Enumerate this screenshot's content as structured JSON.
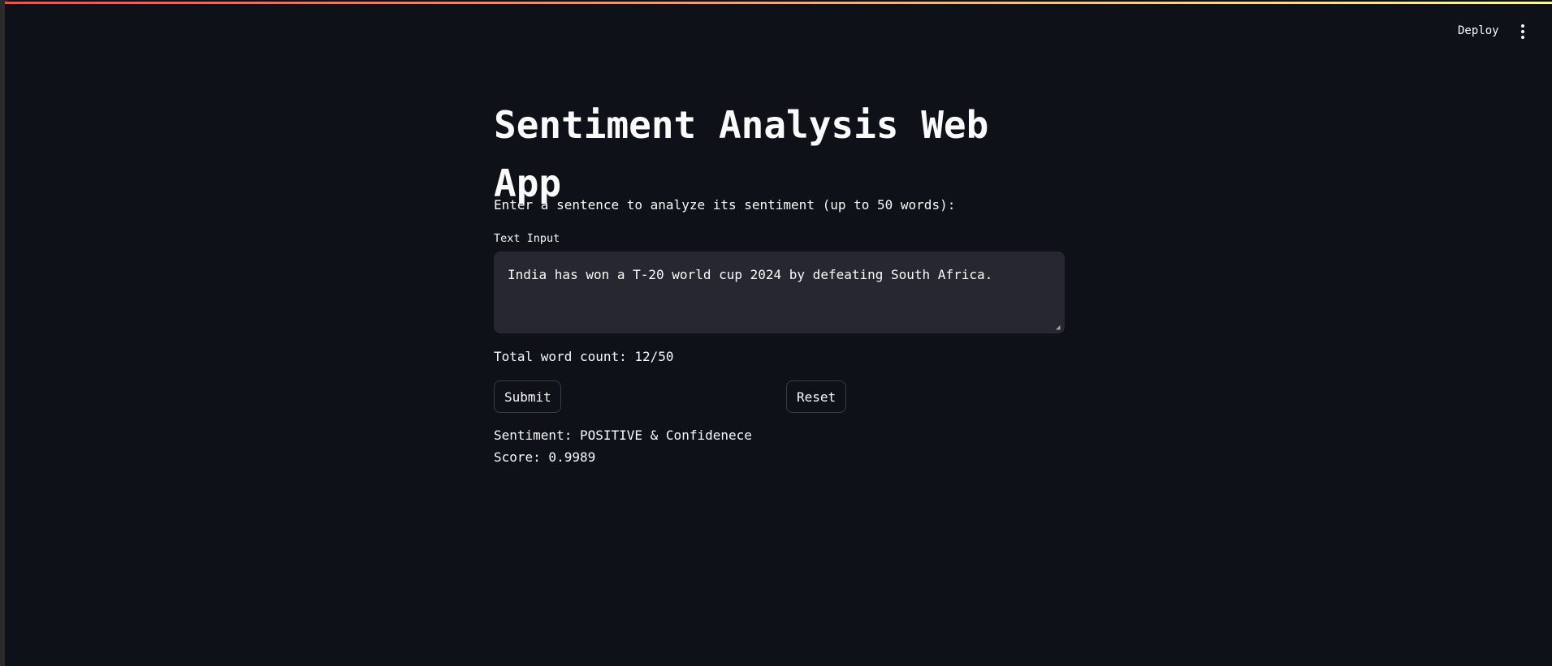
{
  "header": {
    "deploy_label": "Deploy",
    "menu_icon": "kebab-menu-icon"
  },
  "colors": {
    "background": "#0e1117",
    "input_background": "#262730",
    "decoration_start": "#ff4b4b",
    "decoration_end": "#fffd80"
  },
  "main": {
    "title": "Sentiment Analysis Web App",
    "prompt": "Enter a sentence to analyze its sentiment (up to 50 words):",
    "input_label": "Text Input",
    "input_value": "India has won a T-20 world cup 2024 by defeating South Africa.",
    "word_count": "Total word count: 12/50",
    "submit_label": "Submit",
    "reset_label": "Reset",
    "result_line1": "Sentiment: POSITIVE & Confidenece",
    "result_line2": "Score: 0.9989"
  }
}
